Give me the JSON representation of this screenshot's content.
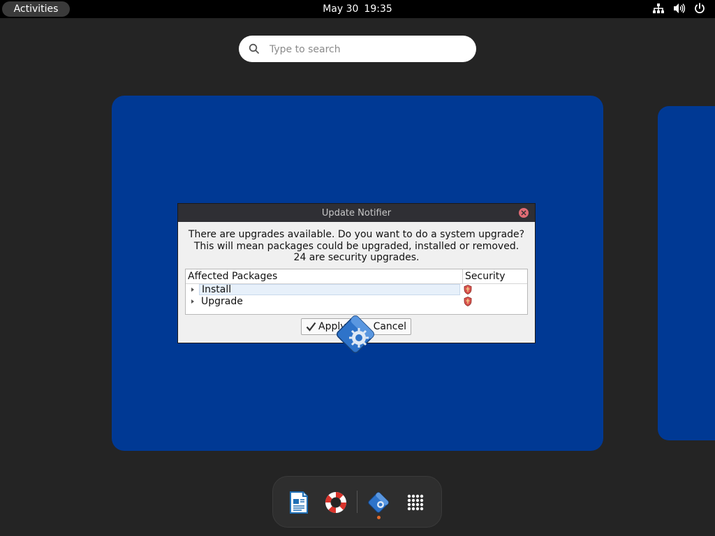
{
  "topbar": {
    "activities_label": "Activities",
    "date": "May 30",
    "time": "19:35",
    "tray_icons": [
      "network-icon",
      "volume-icon",
      "power-icon"
    ]
  },
  "search": {
    "placeholder": "Type to search",
    "value": ""
  },
  "dialog": {
    "title": "Update Notifier",
    "message_lines": [
      "There are upgrades available. Do you want to do a system upgrade?",
      "This will mean packages could be upgraded, installed or removed.",
      "24 are security upgrades."
    ],
    "table": {
      "columns": [
        "Affected Packages",
        "Security"
      ],
      "rows": [
        {
          "name": "Install",
          "security_icon": "shield-icon",
          "selected": true
        },
        {
          "name": "Upgrade",
          "security_icon": "shield-icon",
          "selected": false
        }
      ]
    },
    "buttons": {
      "apply": "Apply",
      "cancel": "Cancel"
    }
  },
  "dash": {
    "items": [
      {
        "name": "writer-app-icon"
      },
      {
        "name": "help-app-icon"
      },
      {
        "name": "update-notifier-app-icon",
        "running": true
      },
      {
        "name": "show-apps-icon"
      }
    ]
  },
  "colors": {
    "workspace_bg": "#003994",
    "desktop_bg": "#242424",
    "running_indicator": "#e26a2c"
  }
}
